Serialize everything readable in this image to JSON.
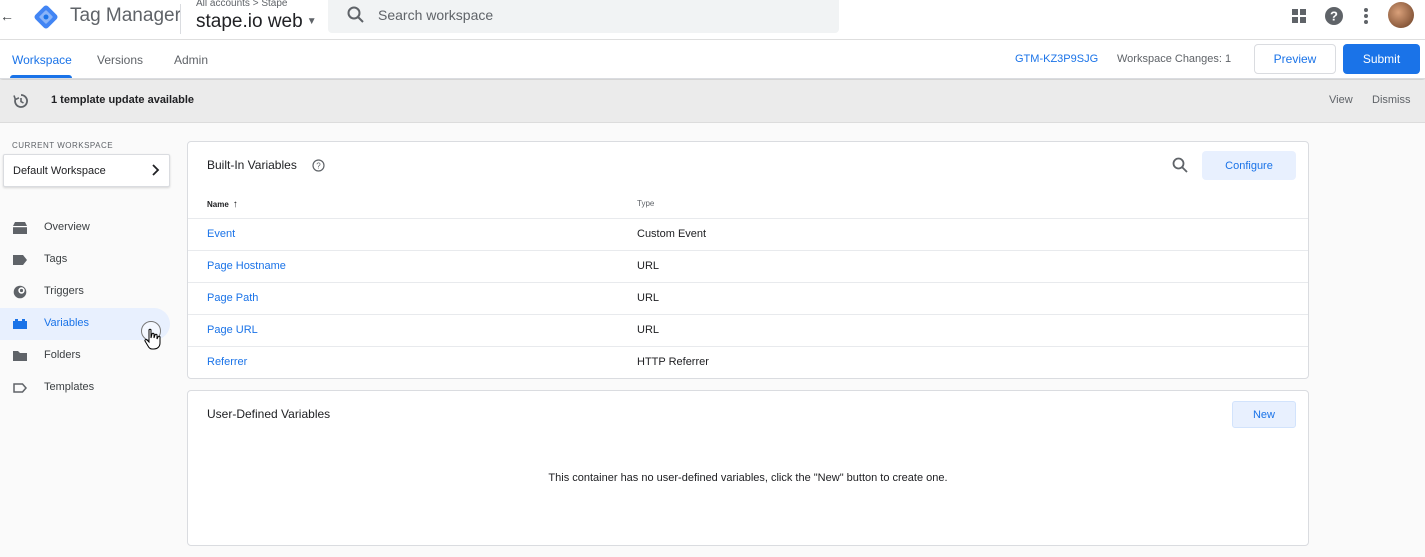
{
  "header": {
    "back_glyph": "←",
    "app_title": "Tag Manager",
    "breadcrumb": "All accounts > Stape",
    "container_name": "stape.io web",
    "search_placeholder": "Search workspace",
    "icons": [
      "back-arrow-icon",
      "tag-manager-logo-icon",
      "search-icon",
      "apps-grid-icon",
      "help-icon",
      "more-vert-icon",
      "avatar"
    ]
  },
  "nav": {
    "tabs": [
      {
        "label": "Workspace",
        "active": true
      },
      {
        "label": "Versions",
        "active": false
      },
      {
        "label": "Admin",
        "active": false
      }
    ],
    "container_id": "GTM-KZ3P9SJG",
    "workspace_changes": "Workspace Changes: 1",
    "preview_label": "Preview",
    "submit_label": "Submit"
  },
  "banner": {
    "message": "1 template update available",
    "view_label": "View",
    "dismiss_label": "Dismiss"
  },
  "sidebar": {
    "section_label": "CURRENT WORKSPACE",
    "workspace_name": "Default Workspace",
    "items": [
      {
        "label": "Overview",
        "icon": "overview-icon"
      },
      {
        "label": "Tags",
        "icon": "tag-icon"
      },
      {
        "label": "Triggers",
        "icon": "trigger-icon"
      },
      {
        "label": "Variables",
        "icon": "variables-icon",
        "active": true
      },
      {
        "label": "Folders",
        "icon": "folder-icon"
      },
      {
        "label": "Templates",
        "icon": "template-icon"
      }
    ]
  },
  "builtin": {
    "title": "Built-In Variables",
    "configure_label": "Configure",
    "col_name": "Name",
    "col_type": "Type",
    "sort_glyph": "↑",
    "rows": [
      {
        "name": "Event",
        "type": "Custom Event"
      },
      {
        "name": "Page Hostname",
        "type": "URL"
      },
      {
        "name": "Page Path",
        "type": "URL"
      },
      {
        "name": "Page URL",
        "type": "URL"
      },
      {
        "name": "Referrer",
        "type": "HTTP Referrer"
      }
    ]
  },
  "user_defined": {
    "title": "User-Defined Variables",
    "new_label": "New",
    "empty_message": "This container has no user-defined variables, click the \"New\" button to create one."
  },
  "colors": {
    "accent": "#1a73e8",
    "accent_light": "#e8f0fe",
    "banner_bg": "#ebebeb"
  }
}
